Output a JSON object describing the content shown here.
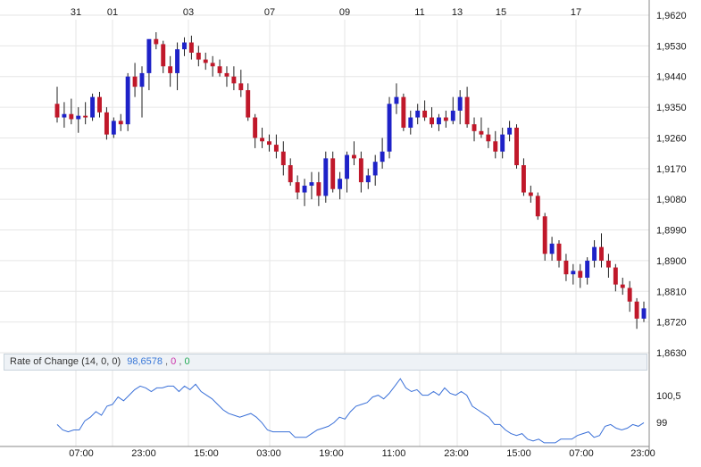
{
  "chart_data": [
    {
      "type": "candlestick",
      "ylim": [
        1.863,
        1.962
      ],
      "y_ticks": [
        "1,9620",
        "1,9530",
        "1,9440",
        "1,9350",
        "1,9260",
        "1,9170",
        "1,9080",
        "1,8990",
        "1,8900",
        "1,8810",
        "1,8720",
        "1,8630"
      ],
      "y_tick_values": [
        1.962,
        1.953,
        1.944,
        1.935,
        1.926,
        1.917,
        1.908,
        1.899,
        1.89,
        1.881,
        1.872,
        1.863
      ],
      "top_date_labels": [
        "31",
        "01",
        "03",
        "07",
        "09",
        "11",
        "13",
        "15",
        "17"
      ],
      "colors": {
        "up": "#1e22c8",
        "down": "#c0182a",
        "wick": "#202020",
        "grid": "#e6e6e6"
      },
      "candles": [
        [
          1.936,
          1.941,
          1.9305,
          1.932
        ],
        [
          1.932,
          1.9365,
          1.929,
          1.933
        ],
        [
          1.933,
          1.9375,
          1.93,
          1.9315
        ],
        [
          1.9315,
          1.935,
          1.9275,
          1.9325
        ],
        [
          1.9325,
          1.9365,
          1.93,
          1.932
        ],
        [
          1.932,
          1.939,
          1.931,
          1.938
        ],
        [
          1.938,
          1.9395,
          1.932,
          1.9335
        ],
        [
          1.9335,
          1.935,
          1.9255,
          1.927
        ],
        [
          1.927,
          1.932,
          1.926,
          1.931
        ],
        [
          1.931,
          1.933,
          1.928,
          1.93
        ],
        [
          1.93,
          1.945,
          1.928,
          1.944
        ],
        [
          1.944,
          1.948,
          1.938,
          1.941
        ],
        [
          1.941,
          1.947,
          1.932,
          1.945
        ],
        [
          1.945,
          1.954,
          1.94,
          1.955
        ],
        [
          1.955,
          1.957,
          1.952,
          1.9535
        ],
        [
          1.9535,
          1.9545,
          1.945,
          1.947
        ],
        [
          1.947,
          1.95,
          1.941,
          1.945
        ],
        [
          1.945,
          1.954,
          1.94,
          1.952
        ],
        [
          1.952,
          1.9555,
          1.95,
          1.954
        ],
        [
          1.954,
          1.956,
          1.949,
          1.951
        ],
        [
          1.951,
          1.953,
          1.947,
          1.949
        ],
        [
          1.949,
          1.951,
          1.946,
          1.948
        ],
        [
          1.948,
          1.95,
          1.944,
          1.947
        ],
        [
          1.947,
          1.949,
          1.944,
          1.945
        ],
        [
          1.945,
          1.947,
          1.941,
          1.944
        ],
        [
          1.944,
          1.947,
          1.94,
          1.942
        ],
        [
          1.942,
          1.946,
          1.938,
          1.94
        ],
        [
          1.94,
          1.942,
          1.931,
          1.932
        ],
        [
          1.932,
          1.933,
          1.923,
          1.926
        ],
        [
          1.926,
          1.929,
          1.923,
          1.925
        ],
        [
          1.925,
          1.927,
          1.922,
          1.924
        ],
        [
          1.924,
          1.927,
          1.92,
          1.922
        ],
        [
          1.922,
          1.925,
          1.915,
          1.918
        ],
        [
          1.918,
          1.92,
          1.912,
          1.913
        ],
        [
          1.913,
          1.915,
          1.908,
          1.91
        ],
        [
          1.91,
          1.914,
          1.906,
          1.912
        ],
        [
          1.912,
          1.916,
          1.908,
          1.913
        ],
        [
          1.913,
          1.916,
          1.906,
          1.909
        ],
        [
          1.909,
          1.922,
          1.907,
          1.92
        ],
        [
          1.92,
          1.922,
          1.91,
          1.911
        ],
        [
          1.911,
          1.916,
          1.908,
          1.914
        ],
        [
          1.914,
          1.922,
          1.91,
          1.921
        ],
        [
          1.921,
          1.925,
          1.918,
          1.92
        ],
        [
          1.92,
          1.922,
          1.91,
          1.913
        ],
        [
          1.913,
          1.917,
          1.911,
          1.915
        ],
        [
          1.915,
          1.921,
          1.912,
          1.919
        ],
        [
          1.919,
          1.926,
          1.917,
          1.922
        ],
        [
          1.922,
          1.938,
          1.92,
          1.936
        ],
        [
          1.936,
          1.942,
          1.933,
          1.938
        ],
        [
          1.938,
          1.939,
          1.928,
          1.929
        ],
        [
          1.929,
          1.934,
          1.927,
          1.932
        ],
        [
          1.932,
          1.936,
          1.93,
          1.934
        ],
        [
          1.934,
          1.937,
          1.931,
          1.932
        ],
        [
          1.932,
          1.935,
          1.929,
          1.93
        ],
        [
          1.93,
          1.933,
          1.928,
          1.932
        ],
        [
          1.932,
          1.934,
          1.929,
          1.931
        ],
        [
          1.931,
          1.938,
          1.93,
          1.934
        ],
        [
          1.934,
          1.94,
          1.93,
          1.938
        ],
        [
          1.938,
          1.941,
          1.929,
          1.93
        ],
        [
          1.93,
          1.932,
          1.925,
          1.928
        ],
        [
          1.928,
          1.932,
          1.926,
          1.927
        ],
        [
          1.927,
          1.929,
          1.923,
          1.925
        ],
        [
          1.925,
          1.928,
          1.92,
          1.922
        ],
        [
          1.922,
          1.929,
          1.92,
          1.927
        ],
        [
          1.927,
          1.931,
          1.925,
          1.929
        ],
        [
          1.929,
          1.93,
          1.917,
          1.918
        ],
        [
          1.918,
          1.92,
          1.909,
          1.91
        ],
        [
          1.91,
          1.912,
          1.907,
          1.909
        ],
        [
          1.909,
          1.91,
          1.902,
          1.903
        ],
        [
          1.903,
          1.904,
          1.89,
          1.892
        ],
        [
          1.892,
          1.897,
          1.89,
          1.895
        ],
        [
          1.895,
          1.896,
          1.888,
          1.89
        ],
        [
          1.89,
          1.892,
          1.884,
          1.886
        ],
        [
          1.886,
          1.889,
          1.883,
          1.887
        ],
        [
          1.887,
          1.889,
          1.882,
          1.885
        ],
        [
          1.885,
          1.891,
          1.883,
          1.89
        ],
        [
          1.89,
          1.896,
          1.888,
          1.894
        ],
        [
          1.894,
          1.898,
          1.888,
          1.89
        ],
        [
          1.89,
          1.892,
          1.885,
          1.888
        ],
        [
          1.888,
          1.889,
          1.881,
          1.883
        ],
        [
          1.883,
          1.885,
          1.88,
          1.882
        ],
        [
          1.882,
          1.884,
          1.875,
          1.878
        ],
        [
          1.878,
          1.879,
          1.87,
          1.873
        ],
        [
          1.873,
          1.878,
          1.872,
          1.876
        ]
      ]
    },
    {
      "type": "line",
      "series": [
        {
          "values": [
            99.0,
            98.7,
            98.6,
            98.7,
            98.7,
            99.2,
            99.4,
            99.7,
            99.5,
            100.0,
            100.1,
            100.5,
            100.3,
            100.6,
            100.9,
            101.1,
            101.0,
            100.8,
            101.0,
            101.0,
            101.1,
            101.1,
            100.8,
            101.1,
            100.9,
            101.2,
            100.8,
            100.6,
            100.4,
            100.1,
            99.8,
            99.6,
            99.5,
            99.4,
            99.5,
            99.6,
            99.4,
            99.1,
            98.7,
            98.6,
            98.6,
            98.6,
            98.6,
            98.3,
            98.3,
            98.3,
            98.5,
            98.7,
            98.8,
            98.9,
            99.1,
            99.4,
            99.3,
            99.7,
            100.0,
            100.1,
            100.2,
            100.5,
            100.6,
            100.4,
            100.7,
            101.1,
            101.5,
            101.0,
            100.8,
            100.9,
            100.6,
            100.6,
            100.8,
            100.6,
            101.0,
            100.7,
            100.6,
            100.8,
            100.6,
            100.0,
            99.8,
            99.6,
            99.4,
            99.0,
            99.0,
            98.7,
            98.5,
            98.4,
            98.5,
            98.2,
            98.1,
            98.2,
            98.0,
            98.0,
            98.0,
            98.2,
            98.2,
            98.2,
            98.4,
            98.5,
            98.6,
            98.3,
            98.4,
            98.9,
            99.0,
            98.8,
            98.7,
            98.8,
            99.0,
            98.9,
            99.1
          ]
        }
      ],
      "legend": {
        "name": "Rate of Change (14, 0, 0)",
        "value": "98,6578",
        "v2": "0",
        "v3": "0",
        "sep": ","
      },
      "y_ticks": [
        "100,5",
        "99"
      ],
      "y_tick_values": [
        100.5,
        99.0
      ],
      "ylim": [
        97.8,
        101.8
      ],
      "line_color": "#3a70d8"
    }
  ],
  "x_axis": {
    "time_labels": [
      "07:00",
      "23:00",
      "15:00",
      "03:00",
      "19:00",
      "11:00",
      "23:00",
      "15:00",
      "07:00",
      "23:00"
    ]
  }
}
